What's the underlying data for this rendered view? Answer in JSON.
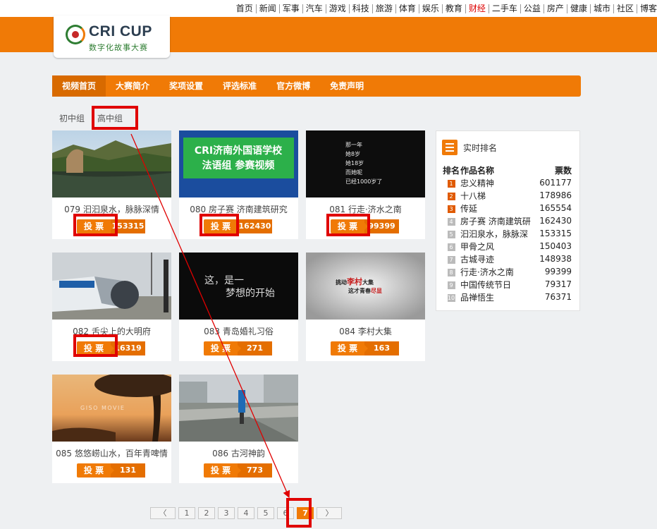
{
  "topnav": [
    "首页",
    "新闻",
    "军事",
    "汽车",
    "游戏",
    "科技",
    "旅游",
    "体育",
    "娱乐",
    "教育",
    "财经",
    "二手车",
    "公益",
    "房产",
    "健康",
    "城市",
    "社区",
    "博客"
  ],
  "logo": {
    "title": "CRI CUP",
    "subtitle": "数字化故事大赛"
  },
  "mainnav": [
    "视频首页",
    "大赛简介",
    "奖项设置",
    "评选标准",
    "官方微博",
    "免责声明"
  ],
  "tabs": [
    "初中组",
    "高中组"
  ],
  "vote_label": "投 票",
  "cards": [
    {
      "title": "079 汩汩泉水，脉脉深情",
      "votes": "153315",
      "thumb_text": ""
    },
    {
      "title": "080 房子赛 济南建筑研究",
      "votes": "162430",
      "thumb_text": "CRI济南外国语学校\n法语组 参赛视频"
    },
    {
      "title": "081 行走·济水之南",
      "votes": "99399",
      "thumb_text": "那一年\n她8岁\n她18岁\n而她呢\n已经1000岁了"
    },
    {
      "title": "082 舌尖上的大明府",
      "votes": "16319",
      "thumb_text": ""
    },
    {
      "title": "083 青岛婚礼习俗",
      "votes": "271",
      "thumb_text": "这，是一\n梦想的开始"
    },
    {
      "title": "084 李村大集",
      "votes": "163",
      "thumb_text": "挑动李村大集\n这才青春尽显"
    },
    {
      "title": "085 悠悠崂山水，百年青啤情",
      "votes": "131",
      "thumb_text": "GISO MOVIE"
    },
    {
      "title": "086 古河神韵",
      "votes": "773",
      "thumb_text": ""
    }
  ],
  "ranking": {
    "title": "实时排名",
    "headers": [
      "排名",
      "作品名称",
      "票数"
    ],
    "rows": [
      {
        "rank": "1",
        "name": "忠义精神",
        "votes": "601177"
      },
      {
        "rank": "2",
        "name": "十八梯",
        "votes": "178986"
      },
      {
        "rank": "3",
        "name": "传延",
        "votes": "165554"
      },
      {
        "rank": "4",
        "name": "房子赛 济南建筑研",
        "votes": "162430"
      },
      {
        "rank": "5",
        "name": "汩汩泉水，脉脉深",
        "votes": "153315"
      },
      {
        "rank": "6",
        "name": "甲骨之风",
        "votes": "150403"
      },
      {
        "rank": "7",
        "name": "古城寻迹",
        "votes": "148938"
      },
      {
        "rank": "8",
        "name": "行走·济水之南",
        "votes": "99399"
      },
      {
        "rank": "9",
        "name": "中国传统节日",
        "votes": "79317"
      },
      {
        "rank": "10",
        "name": "品禅悟生",
        "votes": "76371"
      }
    ]
  },
  "pager": {
    "prev": "〈",
    "pages": [
      "1",
      "2",
      "3",
      "4",
      "5",
      "6",
      "7"
    ],
    "next": "〉",
    "current": "7"
  },
  "colors": {
    "accent": "#f07a06",
    "highlight_box": "#e00000"
  }
}
